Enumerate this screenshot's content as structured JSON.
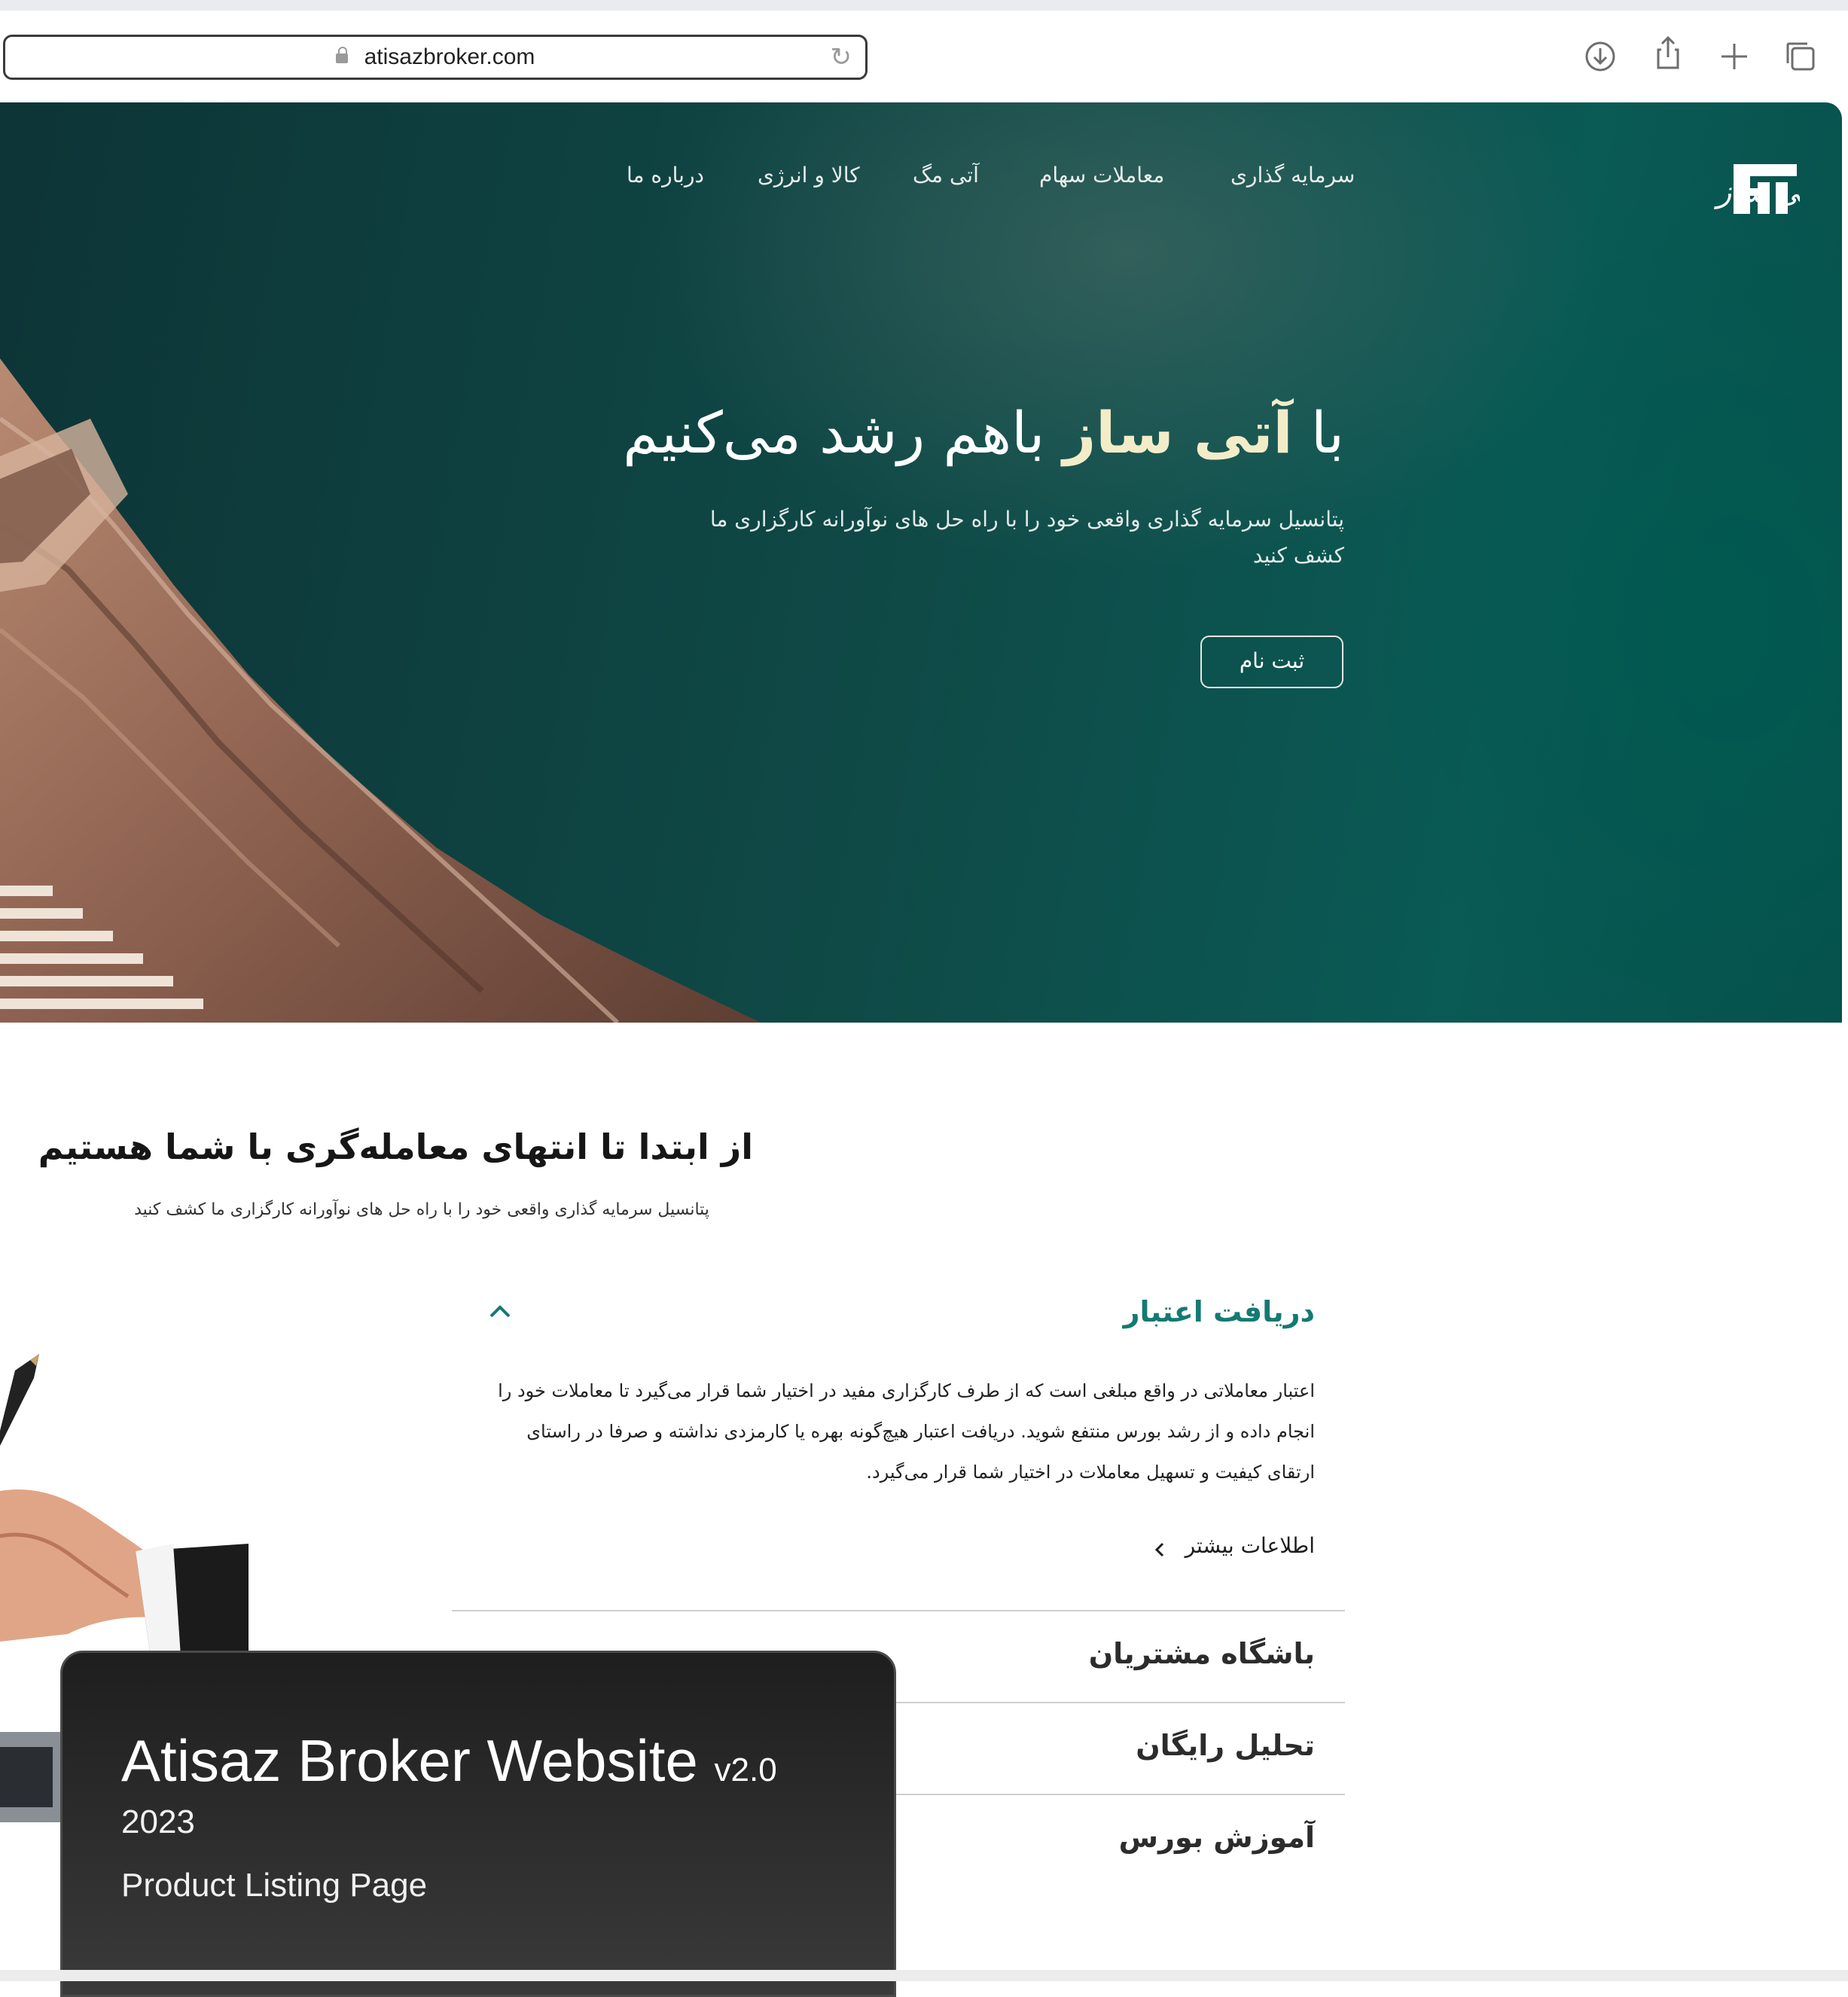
{
  "browser": {
    "url": "atisazbroker.com"
  },
  "header": {
    "logo_text": "کارگزاری آتی ساز",
    "nav": [
      "سرمایه گذاری",
      "معاملات سهام",
      "آتی مگ",
      "کالا و انرژی",
      "درباره ما"
    ]
  },
  "hero": {
    "title_prefix": "با",
    "title_brand": "آتی ساز",
    "title_suffix": "باهم رشد می‌کنیم",
    "subtitle": "پتانسیل سرمایه گذاری واقعی خود را با راه حل های نوآورانه کارگزاری ما کشف کنید",
    "signup_label": "ثبت نام"
  },
  "section": {
    "title": "از ابتدا تا انتهای معامله‌گری با شما هستیم",
    "subtitle": "پتانسیل سرمایه گذاری واقعی خود را با راه حل های نوآورانه کارگزاری ما کشف کنید"
  },
  "accordion": {
    "open_item": {
      "title": "دریافت اعتبار",
      "body": "اعتبار معاملاتی در واقع مبلغی است که از طرف کارگزاری مفید در اختیار شما قرار می‌گیرد تا معاملات خود را انجام داده و از رشد بورس منتفع شوید. دریافت اعتبار هیچ‌گونه بهره یا کارمزدی نداشته و صرفا در راستای ارتقای کیفیت و تسهیل معاملات در اختیار شما قرار می‌گیرد.",
      "more_label": "اطلاعات بیشتر"
    },
    "items": [
      "باشگاه مشتریان",
      "تحلیل رایگان",
      "آموزش بورس"
    ]
  },
  "card": {
    "title": "Atisaz Broker Website",
    "version": "v2.0",
    "year": "2023",
    "type": "Product Listing Page"
  },
  "colors": {
    "hero_bg": "#0f4a47",
    "accent": "#147a73",
    "brand_text": "#f3ecc9"
  }
}
